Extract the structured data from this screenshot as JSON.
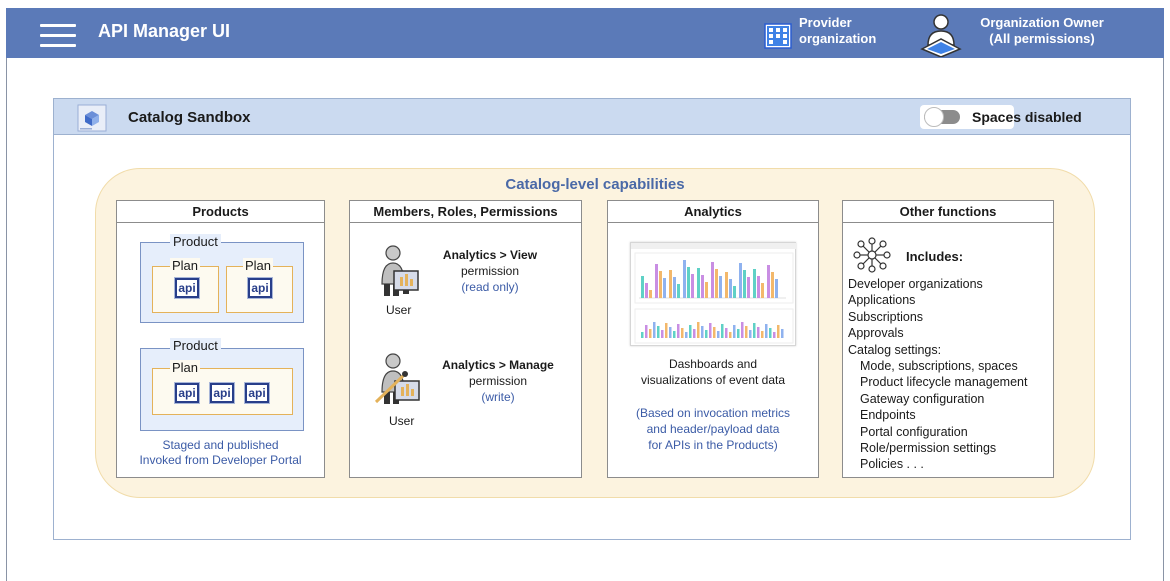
{
  "header": {
    "app_title": "API Manager UI",
    "provider_line1": "Provider",
    "provider_line2": "organization",
    "owner_line1": "Organization Owner",
    "owner_line2": "(All permissions)"
  },
  "catalog": {
    "title": "Catalog Sandbox",
    "spaces_label": "Spaces disabled",
    "spaces_enabled": false
  },
  "capabilities": {
    "title": "Catalog-level capabilities",
    "products": {
      "heading": "Products",
      "product_label": "Product",
      "plan_label": "Plan",
      "api_label": "api",
      "note_line1": "Staged and published",
      "note_line2": "Invoked from Developer Portal"
    },
    "members": {
      "heading": "Members, Roles, Permissions",
      "view_title": "Analytics > View",
      "view_perm": "permission",
      "view_note": "(read only)",
      "manage_title": "Analytics > Manage",
      "manage_perm": "permission",
      "manage_note": "(write)",
      "user_label": "User"
    },
    "analytics": {
      "heading": "Analytics",
      "desc_line1": "Dashboards and",
      "desc_line2": "visualizations of event data",
      "note_line1": "(Based on invocation metrics",
      "note_line2": "and header/payload data",
      "note_line3": "for APIs in the Products)"
    },
    "other": {
      "heading": "Other functions",
      "includes_label": "Includes:",
      "items": [
        "Developer organizations",
        "Applications",
        "Subscriptions",
        "Approvals",
        "Catalog settings:"
      ],
      "settings": [
        "Mode, subscriptions, spaces",
        "Product lifecycle management",
        "Gateway configuration",
        "Endpoints",
        "Portal configuration",
        "Role/permission settings",
        "Policies  . . ."
      ]
    }
  },
  "colors": {
    "header_bg": "#5b7ab8",
    "catalog_header_bg": "#cbdaf0",
    "capabilities_bg": "#fcf3df",
    "accent_blue": "#3b5ba6",
    "plan_border": "#e4b25a"
  }
}
